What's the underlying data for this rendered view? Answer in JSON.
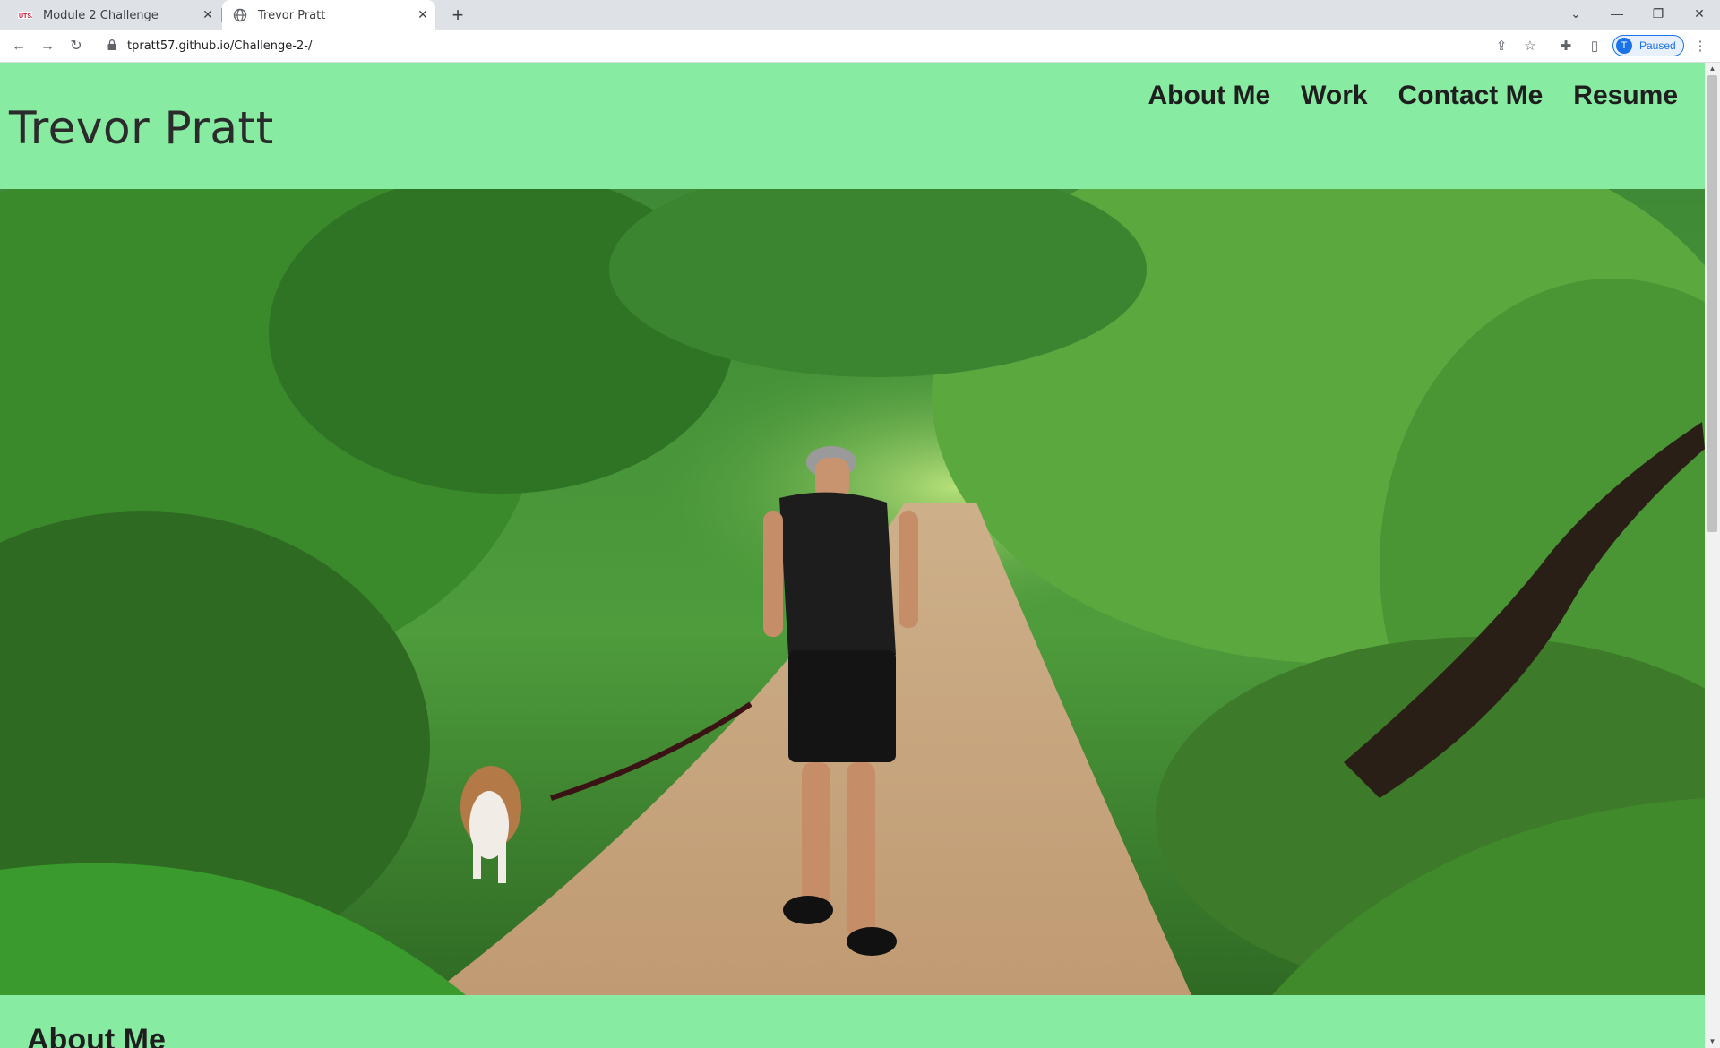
{
  "browser": {
    "tabs": [
      {
        "title": "Module 2 Challenge",
        "icon": "usa-favicon-icon"
      },
      {
        "title": "Trevor Pratt",
        "icon": "globe-icon"
      }
    ],
    "url": "tpratt57.github.io/Challenge-2-/",
    "profile": {
      "initial": "T",
      "status": "Paused"
    }
  },
  "site": {
    "title": "Trevor Pratt",
    "nav": [
      "About Me",
      "Work",
      "Contact Me",
      "Resume"
    ],
    "section_heading": "About Me"
  },
  "colors": {
    "page_background": "#88eba2",
    "text": "#1e1e1e"
  }
}
